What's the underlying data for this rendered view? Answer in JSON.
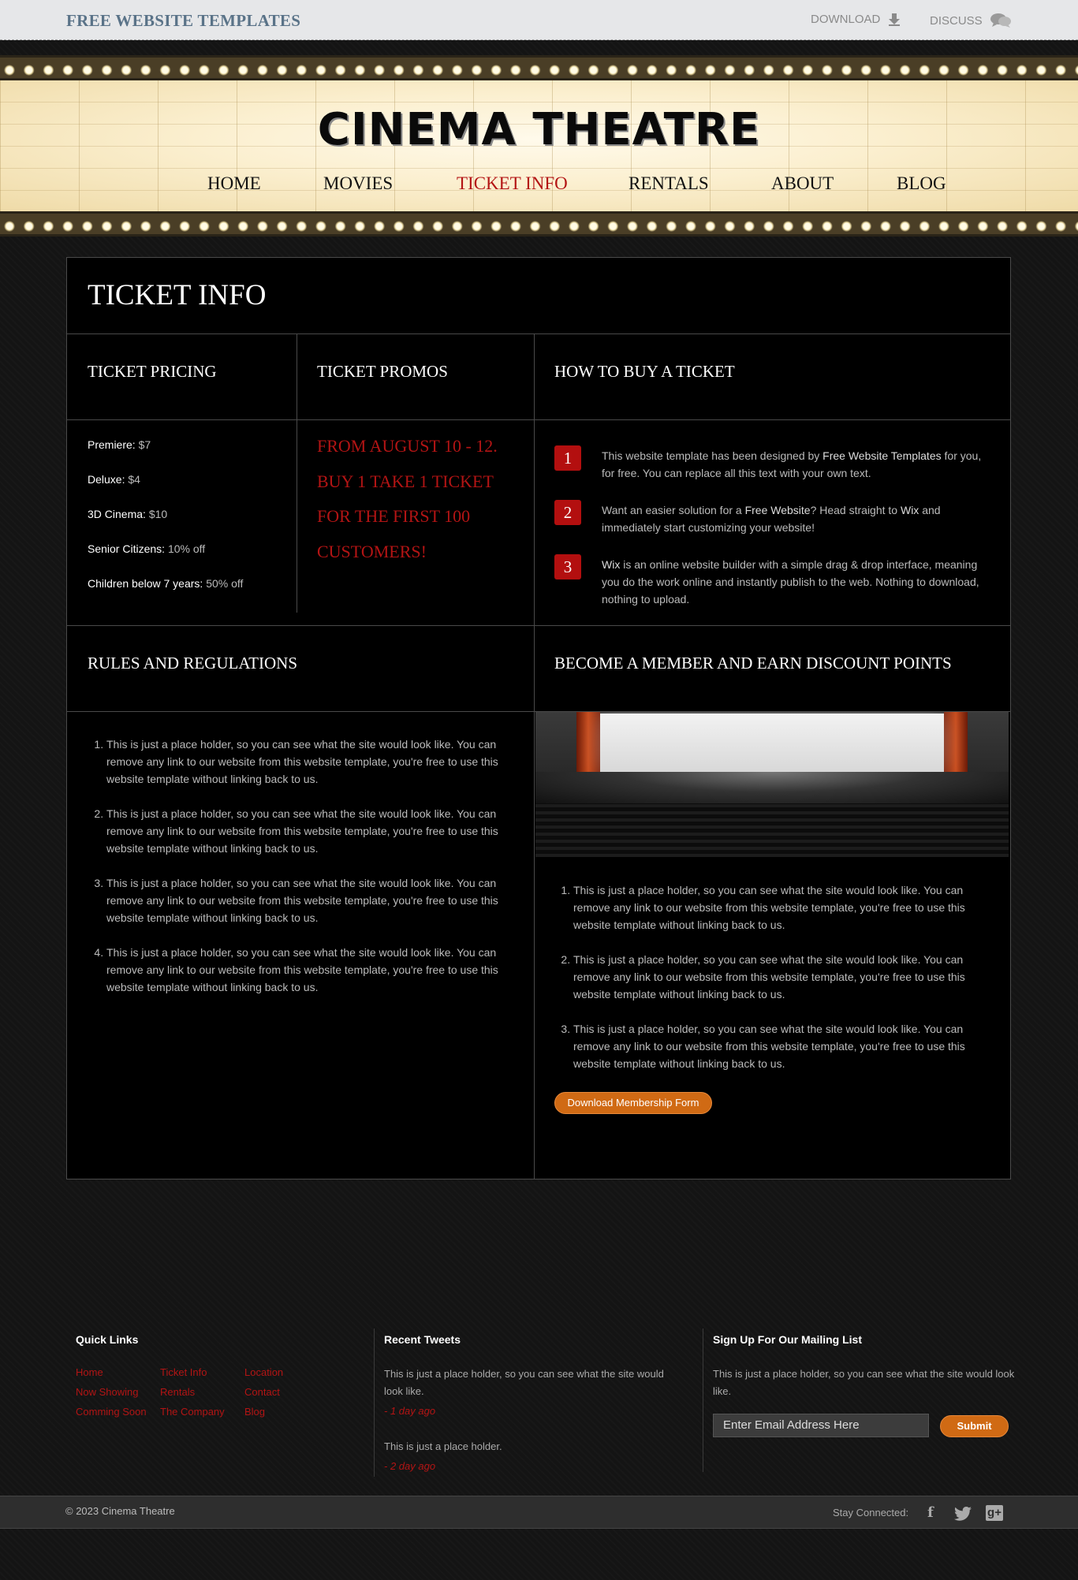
{
  "topbar": {
    "brand": "FREE WEBSITE TEMPLATES",
    "download": "DOWNLOAD",
    "discuss": "DISCUSS"
  },
  "header": {
    "logo": "CINEMA THEATRE"
  },
  "nav": {
    "home": "HOME",
    "movies": "MOVIES",
    "ticket_info": "TICKET INFO",
    "rentals": "RENTALS",
    "about": "ABOUT",
    "blog": "BLOG",
    "active_color": "#b31414"
  },
  "page": {
    "title": "TICKET INFO"
  },
  "pricing": {
    "heading": "TICKET PRICING",
    "items": [
      {
        "label": "Premiere:",
        "value": "$7"
      },
      {
        "label": "Deluxe:",
        "value": "$4"
      },
      {
        "label": "3D Cinema:",
        "value": "$10"
      },
      {
        "label": "Senior Citizens:",
        "value": "10% off"
      },
      {
        "label": "Children below 7 years:",
        "value": "50% off"
      }
    ]
  },
  "promos": {
    "heading": "TICKET PROMOS",
    "text": "FROM AUGUST 10 - 12. BUY 1 TAKE 1 TICKET FOR THE FIRST 100 CUSTOMERS!"
  },
  "howto": {
    "heading": "HOW TO BUY A TICKET",
    "steps": [
      {
        "num": "1",
        "pre": "This website template has been designed by ",
        "link": "Free Website Templates",
        "post": " for you, for free. You can replace all this text with your own text."
      },
      {
        "num": "2",
        "pre": "Want an easier solution for a ",
        "link": "Free Website",
        "mid": "? Head straight to ",
        "link2": "Wix",
        "post": " and immediately start customizing your website!"
      },
      {
        "num": "3",
        "pre": "",
        "link": "Wix",
        "post": " is an online website builder with a simple drag & drop interface, meaning you do the work online and instantly publish to the web. Nothing to download, nothing to upload."
      }
    ]
  },
  "rules": {
    "heading": "RULES AND REGULATIONS",
    "items": [
      "This is just a place holder, so you can see what the site would look like. You can remove any link to our website from this website template, you're free to use this website template without linking back to us.",
      "This is just a place holder, so you can see what the site would look like. You can remove any link to our website from this website template, you're free to use this website template without linking back to us.",
      "This is just a place holder, so you can see what the site would look like. You can remove any link to our website from this website template, you're free to use this website template without linking back to us.",
      "This is just a place holder, so you can see what the site would look like. You can remove any link to our website from this website template, you're free to use this website template without linking back to us."
    ]
  },
  "member": {
    "heading": "BECOME A MEMBER AND EARN DISCOUNT POINTS",
    "items": [
      "This is just a place holder, so you can see what the site would look like. You can remove any link to our website from this website template, you're free to use this website template without linking back to us.",
      "This is just a place holder, so you can see what the site would look like. You can remove any link to our website from this website template, you're free to use this website template without linking back to us.",
      "This is just a place holder, so you can see what the site would look like. You can remove any link to our website from this website template, you're free to use this website template without linking back to us."
    ],
    "button": "Download Membership Form"
  },
  "footer": {
    "quick_links": {
      "heading": "Quick Links",
      "links": [
        "Home",
        "Now Showing",
        "Comming Soon",
        "Ticket Info",
        "Rentals",
        "The Company",
        "Location",
        "Contact",
        "Blog"
      ]
    },
    "tweets": {
      "heading": "Recent Tweets",
      "items": [
        {
          "text": "This is just a place holder, so you can see what the site would look like.",
          "date": "- 1 day ago"
        },
        {
          "text": "This is just a place holder.",
          "date": "- 2 day ago"
        }
      ]
    },
    "mailing": {
      "heading": "Sign Up For Our Mailing List",
      "text": "This is just a place holder, so you can see what the site would look like.",
      "placeholder": "Enter Email Address Here",
      "submit": "Submit"
    },
    "copyright": "© 2023 Cinema Theatre",
    "stay_connected": "Stay Connected:",
    "social": [
      "facebook-icon",
      "twitter-icon",
      "google-plus-icon"
    ]
  }
}
